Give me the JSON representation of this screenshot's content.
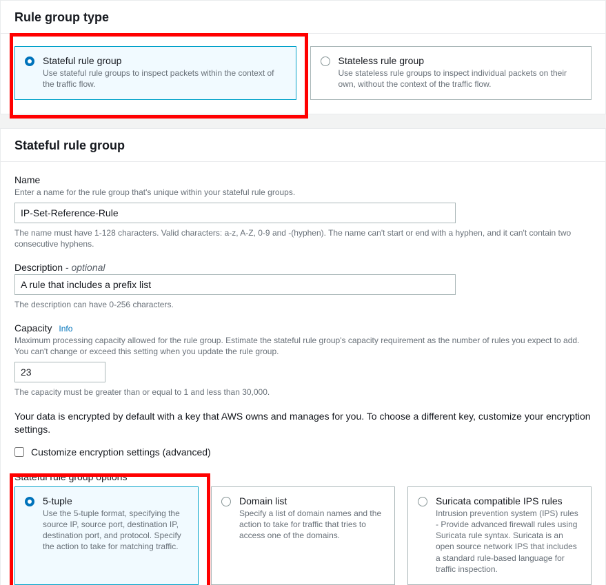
{
  "panel1": {
    "header": "Rule group type",
    "stateful": {
      "title": "Stateful rule group",
      "desc": "Use stateful rule groups to inspect packets within the context of the traffic flow."
    },
    "stateless": {
      "title": "Stateless rule group",
      "desc": "Use stateless rule groups to inspect individual packets on their own, without the context of the traffic flow."
    }
  },
  "panel2": {
    "header": "Stateful rule group",
    "name": {
      "label": "Name",
      "hint_top": "Enter a name for the rule group that's unique within your stateful rule groups.",
      "value": "IP-Set-Reference-Rule",
      "hint_bottom": "The name must have 1-128 characters. Valid characters: a-z, A-Z, 0-9 and -(hyphen). The name can't start or end with a hyphen, and it can't contain two consecutive hyphens."
    },
    "description": {
      "label": "Description",
      "optional": "- optional",
      "value": "A rule that includes a prefix list",
      "hint_bottom": "The description can have 0-256 characters."
    },
    "capacity": {
      "label": "Capacity",
      "info": "Info",
      "hint_top": "Maximum processing capacity allowed for the rule group. Estimate the stateful rule group's capacity requirement as the number of rules you expect to add. You can't change or exceed this setting when you update the rule group.",
      "value": "23",
      "hint_bottom": "The capacity must be greater than or equal to 1 and less than 30,000."
    },
    "encryption_note": "Your data is encrypted by default with a key that AWS owns and manages for you. To choose a different key, customize your encryption settings.",
    "customize_label": "Customize encryption settings (advanced)",
    "options_label": "Stateful rule group options",
    "options": {
      "five_tuple": {
        "title": "5-tuple",
        "desc": "Use the 5-tuple format, specifying the source IP, source port, destination IP, destination port, and protocol. Specify the action to take for matching traffic."
      },
      "domain_list": {
        "title": "Domain list",
        "desc": "Specify a list of domain names and the action to take for traffic that tries to access one of the domains."
      },
      "suricata": {
        "title": "Suricata compatible IPS rules",
        "desc": "Intrusion prevention system (IPS) rules - Provide advanced firewall rules using Suricata rule syntax. Suricata is an open source network IPS that includes a standard rule-based language for traffic inspection."
      }
    }
  }
}
